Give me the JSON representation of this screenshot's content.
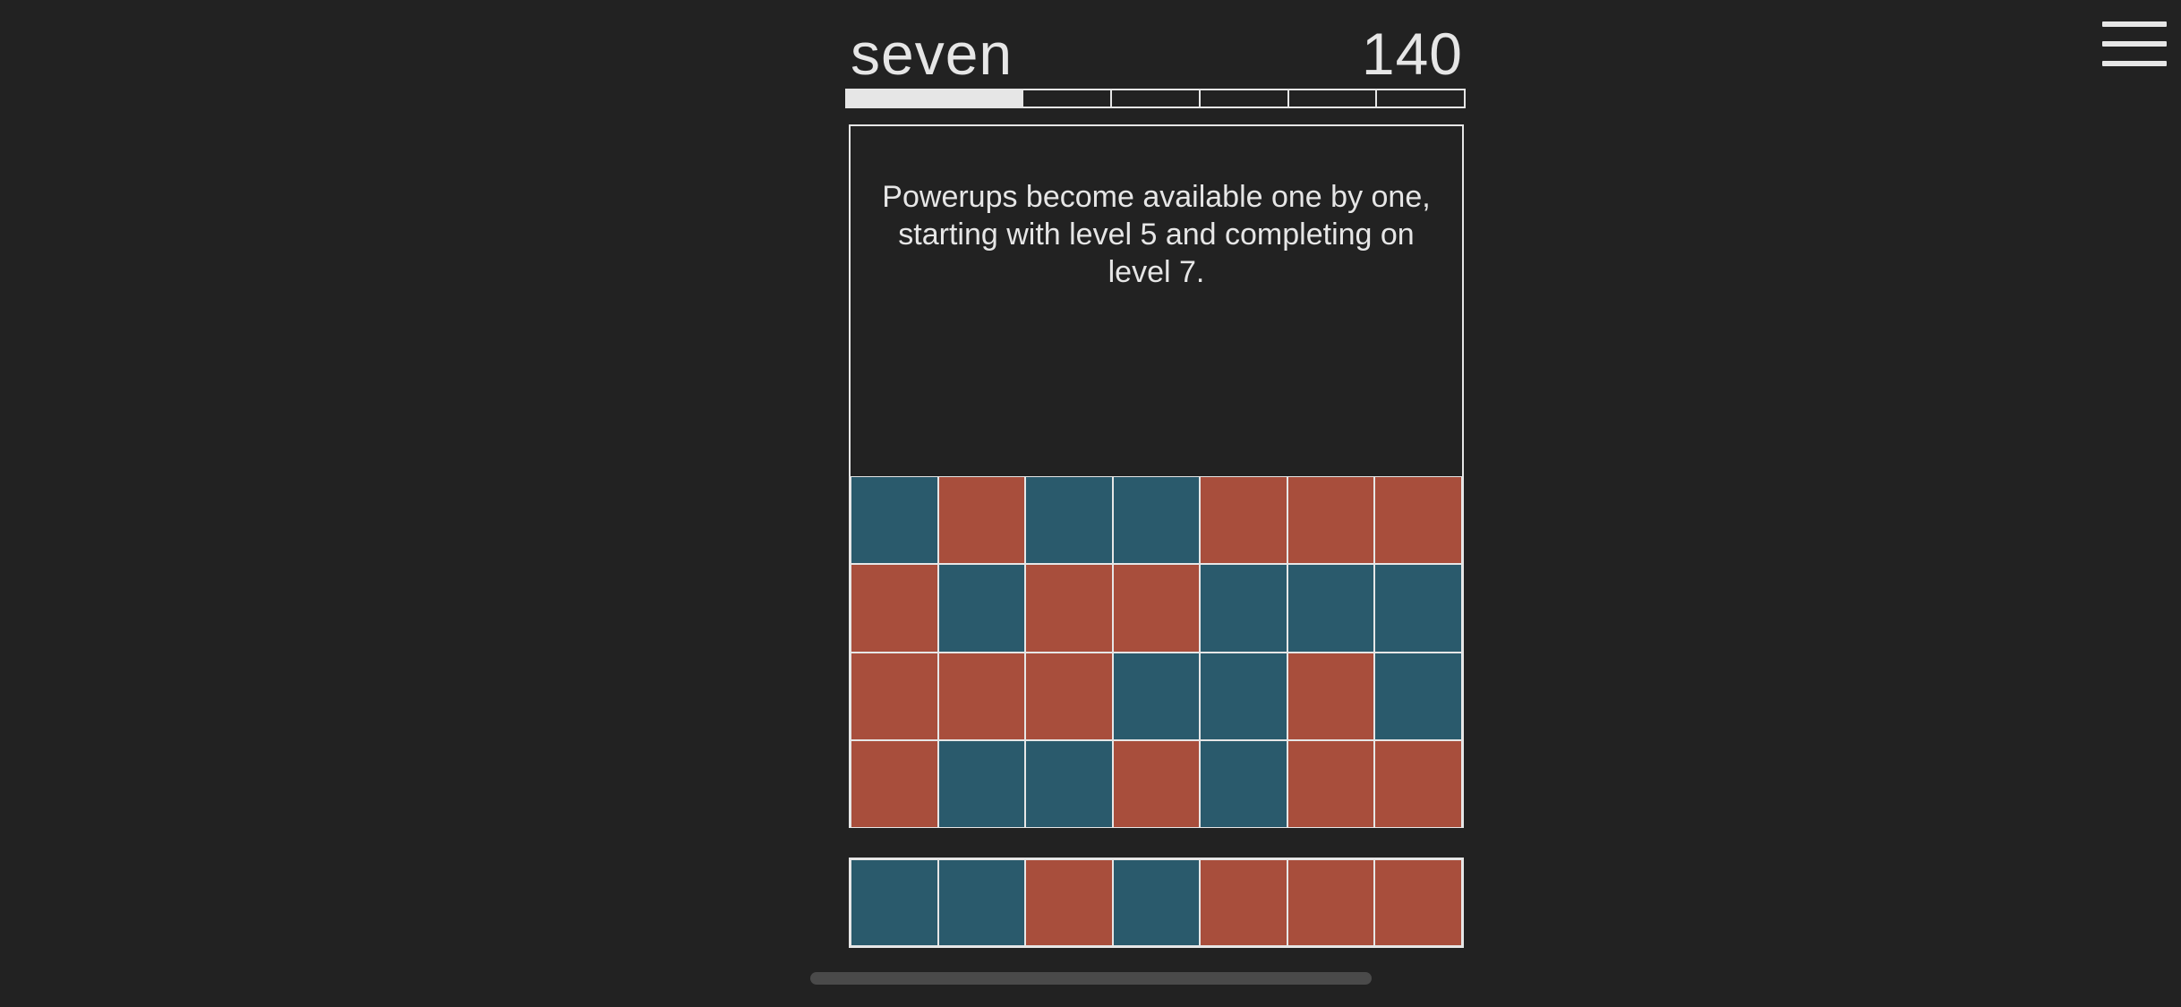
{
  "header": {
    "level_name": "seven",
    "score": "140"
  },
  "progress": {
    "segments_total": 7,
    "segments_done": 2,
    "fill_fraction": 0.286
  },
  "message": {
    "text": "Powerups become available one by one, starting with level 5 and completing on level 7."
  },
  "menu": {
    "icon": "hamburger-menu-icon"
  },
  "colors": {
    "background": "#222222",
    "foreground": "#e6e6e6",
    "blue": "#2a5a6c",
    "red": "#a84e3c",
    "scrollbar": "#4a4a4a"
  },
  "grid": {
    "rows": [
      [
        "blue",
        "red",
        "blue",
        "blue",
        "red",
        "red",
        "red"
      ],
      [
        "red",
        "blue",
        "red",
        "red",
        "blue",
        "blue",
        "blue"
      ],
      [
        "red",
        "red",
        "red",
        "blue",
        "blue",
        "red",
        "blue"
      ],
      [
        "red",
        "blue",
        "blue",
        "red",
        "blue",
        "red",
        "red"
      ]
    ]
  },
  "tray": {
    "tiles": [
      "blue",
      "blue",
      "red",
      "blue",
      "red",
      "red",
      "red"
    ]
  }
}
